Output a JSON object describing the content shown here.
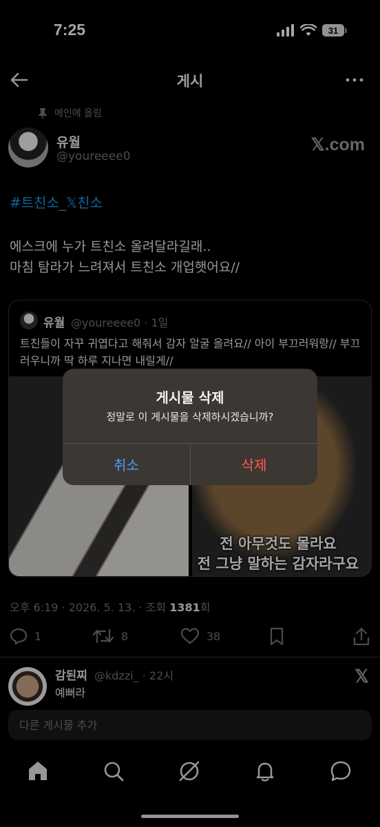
{
  "status_bar": {
    "time": "7:25",
    "battery": "31"
  },
  "topbar": {
    "title": "게시"
  },
  "post": {
    "pinned_label": "메인에 올림",
    "author_name": "유월",
    "author_handle": "@youreeee0",
    "xcom_label": "𝕏.com",
    "hashtag": "#트친소_𝕏친소",
    "text": "에스크에 누가 트친소 올려달라길래..\n마침 탐라가 느려져서 트친소 개업햇어요//",
    "timestamp_prefix": "오후 6:19 · 2026. 5. 13. · 조회 ",
    "views": "1381",
    "views_suffix": "회",
    "replies": "1",
    "reposts": "8",
    "likes": "38"
  },
  "quote": {
    "name": "유월",
    "meta": "@youreeee0 · 1일",
    "text": "트친들이 자꾸 귀엽다고 해줘서 감자 알굴 올려요// 아이 부끄러워랑// 부끄러우니까 딱 하루 지나면 내릴게//",
    "caption_line1": "전 아무것도 몰라요",
    "caption_line2": "전 그냥 말하는 감자라구요"
  },
  "dialog": {
    "title": "게시물 삭제",
    "message": "정말로 이 게시물을 삭제하시겠습니까?",
    "cancel": "취소",
    "delete": "삭제"
  },
  "reply": {
    "name": "감된찌",
    "meta": "@kdzzi_ · 22시",
    "text": "예뻐라",
    "x_label": "𝕏"
  },
  "composer": {
    "placeholder": "다른 게시물 추가"
  },
  "colors": {
    "accent": "#1d9bf0",
    "danger": "#ff5a50",
    "dialog_bg": "#3c3733"
  }
}
